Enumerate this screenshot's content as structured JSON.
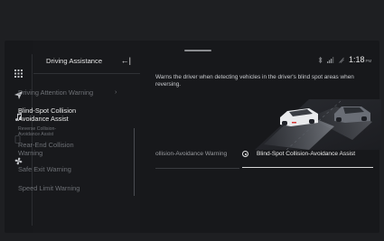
{
  "sidebar": {
    "icons": [
      "apps-grid-icon",
      "navigation-arrow-icon",
      "music-note-icon",
      "phone-icon",
      "fan-icon"
    ]
  },
  "menu": {
    "title": "Driving Assistance",
    "back_icon": "←|",
    "items": [
      {
        "label": "Driving Attention Warning",
        "active": false,
        "chevron": "›"
      },
      {
        "label": "Blind-Spot Collision Avoidance Assist",
        "active": true
      },
      {
        "label": "Reverse Collision-Avoidance Assist",
        "active": false
      },
      {
        "label": "Rear-End Collision Warning",
        "active": false
      },
      {
        "label": "Safe Exit Warning",
        "active": false
      },
      {
        "label": "Speed Limit Warning",
        "active": false
      }
    ]
  },
  "status": {
    "icons": [
      "bluetooth-icon",
      "signal-icon",
      "wifi-icon"
    ],
    "time": "1:18",
    "ampm": "PM"
  },
  "content": {
    "description": "Warns the driver when detecting vehicles in the driver's blind spot areas when reversing.",
    "options": {
      "left_label": "ollision-Avoidance Warning",
      "right_label": "Blind-Spot Collision-Avoidance Assist",
      "selected": "right"
    }
  },
  "colors": {
    "background": "#17181b",
    "accent_text": "#e9e9e9",
    "muted_text": "#6d7075"
  }
}
